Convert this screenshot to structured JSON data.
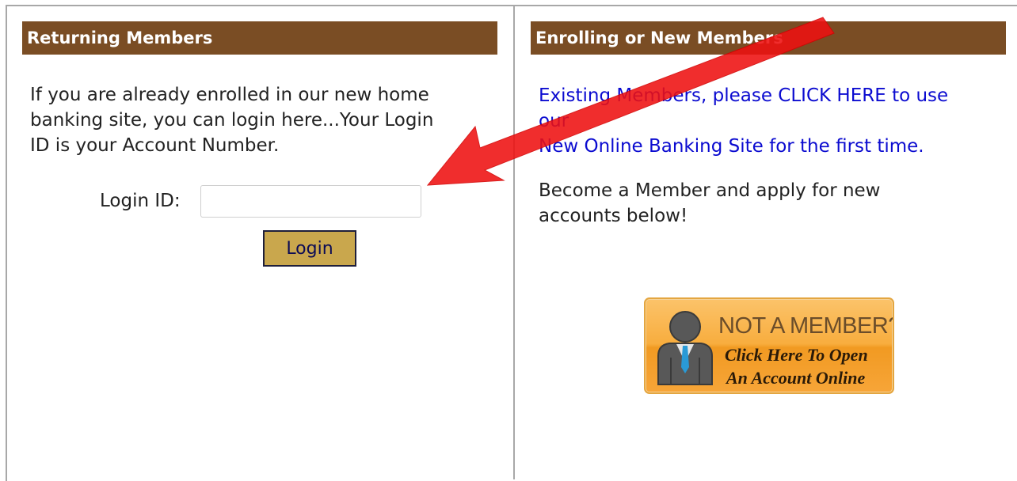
{
  "left_panel": {
    "header": "Returning Members",
    "intro_line1": "If you are already enrolled in our new home",
    "intro_line2": "banking site, you can login here...Your Login",
    "intro_line3": "ID is your Account Number.",
    "login_label": "Login ID:",
    "login_value": "",
    "login_button": "Login"
  },
  "right_panel": {
    "header": "Enrolling or New Members",
    "existing_line1": "Existing Members, please CLICK HERE to use our",
    "existing_line2": "New Online Banking Site for the first time.",
    "become_line1": "Become a Member and apply for new",
    "become_line2": "accounts below!",
    "not_member": {
      "title": "NOT A MEMBER?",
      "line1": "Click Here To Open",
      "line2": "An Account Online"
    }
  },
  "icons": {
    "member_icon": "person-icon",
    "annotation": "red-arrow-icon"
  },
  "colors": {
    "header_bg": "#7a4d24",
    "link": "#0b0bd0",
    "login_button": "#c9a74d",
    "cta_orange": "#f8ad3e",
    "arrow": "#ee1111"
  }
}
